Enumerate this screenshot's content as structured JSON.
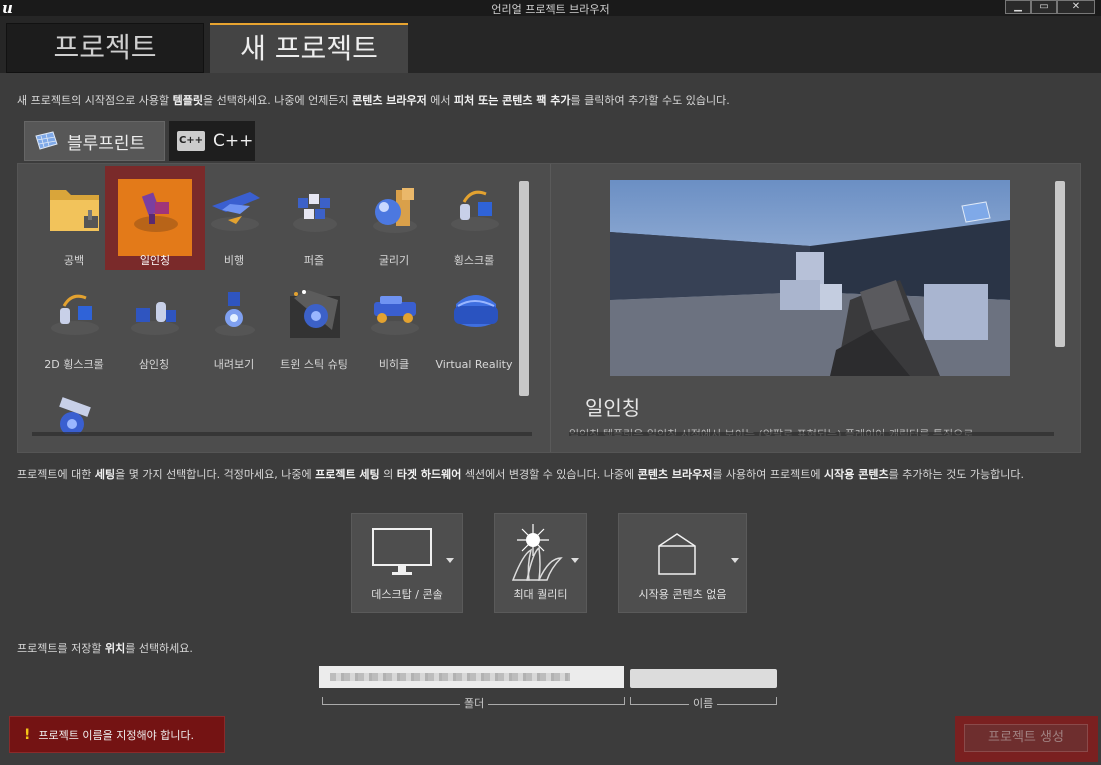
{
  "window": {
    "title": "언리얼 프로젝트 브라우저"
  },
  "main_tabs": [
    {
      "label": "프로젝트"
    },
    {
      "label": "새 프로젝트"
    }
  ],
  "intro": {
    "p1": "새 프로젝트의 시작점으로 사용할 ",
    "b1": "템플릿",
    "p2": "을 선택하세요. 나중에 언제든지 ",
    "b2": "콘텐츠 브라우저",
    "p3": " 에서 ",
    "b3": "피처 또는 콘텐츠 팩 추가",
    "p4": "를 클릭하여 추가할 수도 있습니다."
  },
  "lang_tabs": [
    {
      "label": "블루프린트",
      "icon": "blueprint-icon"
    },
    {
      "label": "C++",
      "icon": "cpp-icon",
      "icon_text": "C++"
    }
  ],
  "templates": [
    {
      "label": "공백",
      "icon": "folder-icon"
    },
    {
      "label": "일인칭",
      "icon": "first-person-icon",
      "selected": true
    },
    {
      "label": "비행",
      "icon": "flying-icon"
    },
    {
      "label": "퍼즐",
      "icon": "puzzle-icon"
    },
    {
      "label": "굴리기",
      "icon": "rolling-icon"
    },
    {
      "label": "횡스크롤",
      "icon": "side-scroller-icon"
    },
    {
      "label": "2D 횡스크롤",
      "icon": "2d-side-scroller-icon"
    },
    {
      "label": "삼인칭",
      "icon": "third-person-icon"
    },
    {
      "label": "내려보기",
      "icon": "top-down-icon"
    },
    {
      "label": "트윈 스틱 슈팅",
      "icon": "twin-stick-icon"
    },
    {
      "label": "비히클",
      "icon": "vehicle-icon"
    },
    {
      "label": "Virtual Reality",
      "icon": "vr-headset-icon"
    },
    {
      "label": "",
      "icon": "vehicle-advanced-icon"
    }
  ],
  "preview": {
    "title": "일인칭",
    "description": "일인칭 템플릿은 일인칭 시점에서 보이는 (양팔로 표현되는) 플레이어 캐릭터를 특징으로"
  },
  "settings": {
    "p1": "프로젝트에 대한 ",
    "b1": "세팅",
    "p2": "을 몇 가지 선택합니다. 걱정마세요, 나중에 ",
    "b2": "프로젝트 세팅",
    "p3": " 의 ",
    "b3": "타겟 하드웨어",
    "p4": " 섹션에서 변경할 수 있습니다. 나중에 ",
    "b4": "콘텐츠 브라우저",
    "p5": "를 사용하여 프로젝트에 ",
    "b5": "시작용 콘텐츠",
    "p6": "를 추가하는 것도 가능합니다."
  },
  "options": [
    {
      "label": "데스크탑 / 콘솔",
      "icon": "monitor-icon"
    },
    {
      "label": "최대 퀄리티",
      "icon": "quality-icon"
    },
    {
      "label": "시작용 콘텐츠 없음",
      "icon": "empty-box-icon"
    }
  ],
  "location": {
    "p1": "프로젝트를 저장할 ",
    "b1": "위치",
    "p2": "를 선택하세요.",
    "folder_label": "폴더",
    "name_label": "이름",
    "name_value": ""
  },
  "error": {
    "icon": "!",
    "message": "프로젝트 이름을 지정해야 합니다."
  },
  "create_button": {
    "label": "프로젝트 생성"
  },
  "colors": {
    "accent": "#e37a19",
    "error_bg": "#741313",
    "tab_highlight": "#e8a430"
  }
}
